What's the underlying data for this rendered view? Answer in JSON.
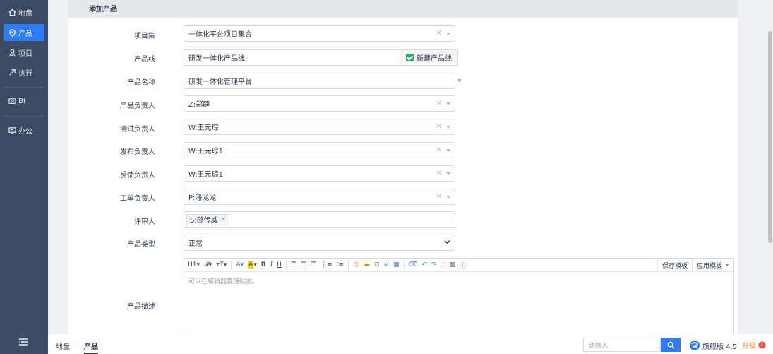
{
  "sidebar": {
    "items": [
      {
        "label": "地盘",
        "icon": "home-icon"
      },
      {
        "label": "产品",
        "icon": "product-icon"
      },
      {
        "label": "项目",
        "icon": "project-icon"
      },
      {
        "label": "执行",
        "icon": "execution-icon"
      },
      {
        "label": "BI",
        "icon": "bi-icon"
      },
      {
        "label": "办公",
        "icon": "office-icon"
      }
    ]
  },
  "panel": {
    "title": "添加产品"
  },
  "form": {
    "program": {
      "label": "项目集",
      "value": "一体化平台项目集合"
    },
    "line": {
      "label": "产品线",
      "value": "研发一体化产品线",
      "addon": "新建产品线"
    },
    "name": {
      "label": "产品名称",
      "value": "研发一体化管理平台",
      "required": "*"
    },
    "po": {
      "label": "产品负责人",
      "value": "Z:郑薛"
    },
    "qd": {
      "label": "测试负责人",
      "value": "W:王元琮"
    },
    "rd": {
      "label": "发布负责人",
      "value": "W:王元琮1"
    },
    "feedback": {
      "label": "反馈负责人",
      "value": "W:王元琮1"
    },
    "ticket": {
      "label": "工单负责人",
      "value": "P:潘龙龙"
    },
    "reviewer": {
      "label": "评审人",
      "tag": "S:邵传威"
    },
    "type": {
      "label": "产品类型",
      "value": "正常"
    },
    "desc": {
      "label": "产品描述",
      "placeholder": "可以在编辑器直接贴图。",
      "save_template": "保存模板",
      "apply_template": "应用模板"
    }
  },
  "bottom": {
    "breadcrumbs": [
      "地盘",
      "产品"
    ],
    "search_placeholder": "请输入",
    "version": "旗舰版 4.5",
    "upgrade": "升级"
  },
  "colors": {
    "sidebar": "#3c4a64",
    "accent": "#2e7cf6",
    "check": "#27b26c",
    "required": "#e84f4f",
    "upgrade": "#e98b28"
  }
}
